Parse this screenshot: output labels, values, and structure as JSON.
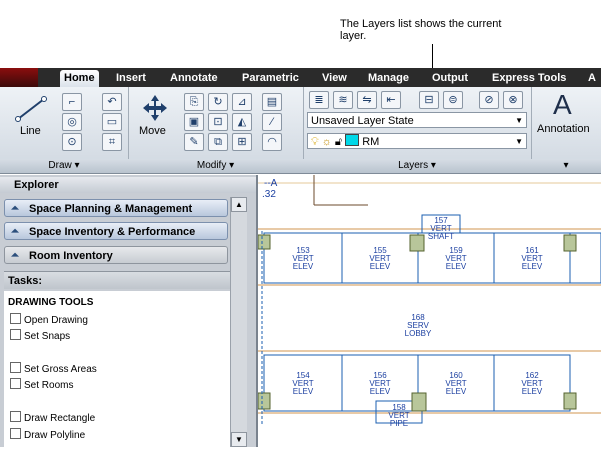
{
  "callout": {
    "text": "The Layers list shows the current layer."
  },
  "tabs": [
    "Home",
    "Insert",
    "Annotate",
    "Parametric",
    "View",
    "Manage",
    "Output",
    "Express Tools",
    "A"
  ],
  "ribbon": {
    "draw": {
      "title": "Draw",
      "line_label": "Line"
    },
    "modify": {
      "title": "Modify",
      "move_label": "Move"
    },
    "layers": {
      "title": "Layers",
      "layer_state": "Unsaved Layer State",
      "current_layer": "RM"
    },
    "annotation": {
      "label": "Annotation",
      "icon_letter": "A"
    }
  },
  "explorer": {
    "title": "Explorer",
    "items": [
      "Space Planning & Management",
      "Space Inventory & Performance",
      "Room Inventory"
    ],
    "tasks_label": "Tasks:",
    "drawing_tools_label": "DRAWING TOOLS",
    "tools": [
      "Open Drawing",
      "Set Snaps",
      "Set Gross Areas",
      "Set Rooms",
      "Draw Rectangle",
      "Draw Polyline"
    ]
  },
  "drawing": {
    "corner_text": [
      "--A",
      ".32"
    ],
    "rooms": [
      {
        "num": "153",
        "type": "VERT ELEV"
      },
      {
        "num": "155",
        "type": "VERT ELEV"
      },
      {
        "num": "159",
        "type": "VERT ELEV"
      },
      {
        "num": "161",
        "type": "VERT ELEV"
      },
      {
        "num": "157",
        "type": "VERT SHAFT"
      },
      {
        "num": "168",
        "type": "SERV LOBBY"
      },
      {
        "num": "154",
        "type": "VERT ELEV"
      },
      {
        "num": "156",
        "type": "VERT ELEV"
      },
      {
        "num": "160",
        "type": "VERT ELEV"
      },
      {
        "num": "162",
        "type": "VERT ELEV"
      },
      {
        "num": "158",
        "type": "VERT PIPE"
      }
    ]
  }
}
